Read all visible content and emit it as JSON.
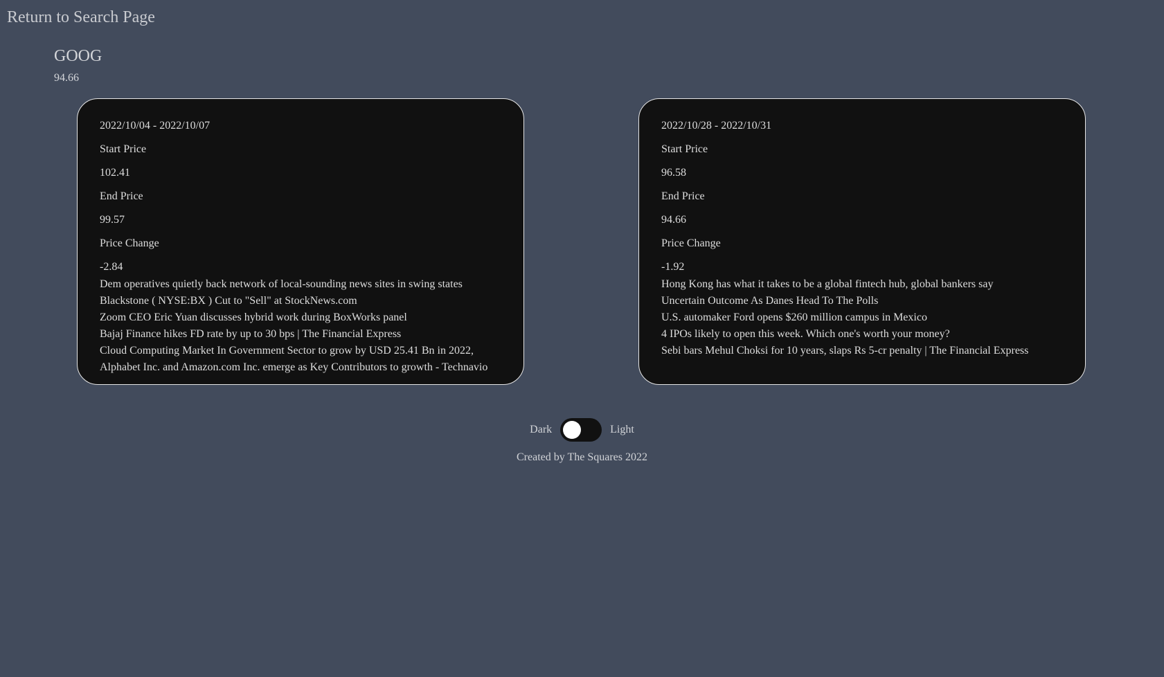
{
  "nav": {
    "return_label": "Return to Search Page"
  },
  "stock": {
    "ticker": "GOOG",
    "price": "94.66"
  },
  "cards": [
    {
      "date_range": "2022/10/04 - 2022/10/07",
      "start_price_label": "Start Price",
      "start_price": "102.41",
      "end_price_label": "End Price",
      "end_price": "99.57",
      "price_change_label": "Price Change",
      "price_change": "-2.84",
      "news": [
        "Dem operatives quietly back network of local-sounding news sites in swing states",
        "Blackstone ( NYSE:BX ) Cut to \"Sell\" at StockNews.com",
        "Zoom CEO Eric Yuan discusses hybrid work during BoxWorks panel",
        "Bajaj Finance hikes FD rate by up to 30 bps | The Financial Express",
        "Cloud Computing Market In Government Sector to grow by USD 25.41 Bn in 2022, Alphabet Inc. and Amazon.com Inc. emerge as Key Contributors to growth - Technavio"
      ]
    },
    {
      "date_range": "2022/10/28 - 2022/10/31",
      "start_price_label": "Start Price",
      "start_price": "96.58",
      "end_price_label": "End Price",
      "end_price": "94.66",
      "price_change_label": "Price Change",
      "price_change": "-1.92",
      "news": [
        "Hong Kong has what it takes to be a global fintech hub, global bankers say",
        "Uncertain Outcome As Danes Head To The Polls",
        "U.S. automaker Ford opens $260 million campus in Mexico",
        "4 IPOs likely to open this week. Which one's worth your money?",
        "Sebi bars Mehul Choksi for 10 years, slaps Rs 5-cr penalty | The Financial Express"
      ]
    }
  ],
  "theme_toggle": {
    "dark_label": "Dark",
    "light_label": "Light",
    "state": "dark"
  },
  "footer": {
    "text": "Created by The Squares 2022"
  },
  "colors": {
    "background": "#424b5c",
    "card_background": "#111111",
    "card_border": "#e6e6e6",
    "text": "#d7d7d7"
  }
}
